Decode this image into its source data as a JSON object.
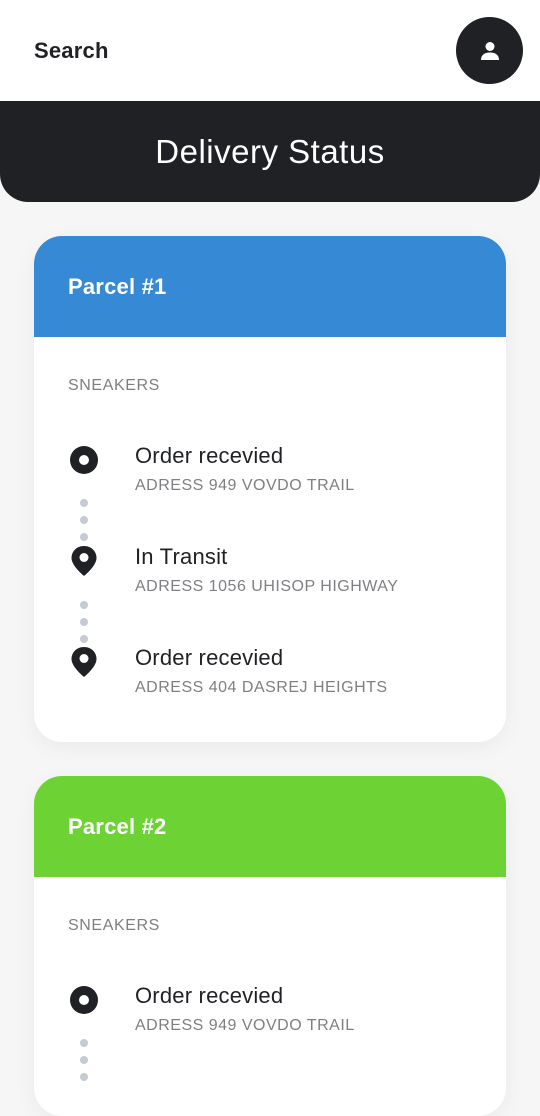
{
  "topbar": {
    "search_label": "Search",
    "profile_icon": "person-icon"
  },
  "header": {
    "title": "Delivery Status"
  },
  "colors": {
    "dark": "#1f2124",
    "parcel_1_accent": "#3689d4",
    "parcel_2_accent": "#6dd334",
    "connector_dots": "#c5cad3"
  },
  "parcels": [
    {
      "title": "Parcel #1",
      "category": "SNEAKERS",
      "steps": [
        {
          "status": "Order recevied",
          "address": "ADRESS 949 VOVDO TRAIL",
          "icon": "circle-dot-icon"
        },
        {
          "status": "In Transit",
          "address": "ADRESS 1056 UHISOP HIGHWAY",
          "icon": "map-pin-icon"
        },
        {
          "status": "Order recevied",
          "address": "ADRESS 404 DASREJ HEIGHTS",
          "icon": "map-pin-icon"
        }
      ]
    },
    {
      "title": "Parcel #2",
      "category": "SNEAKERS",
      "steps": [
        {
          "status": "Order recevied",
          "address": "ADRESS 949 VOVDO TRAIL",
          "icon": "circle-dot-icon"
        }
      ]
    }
  ]
}
